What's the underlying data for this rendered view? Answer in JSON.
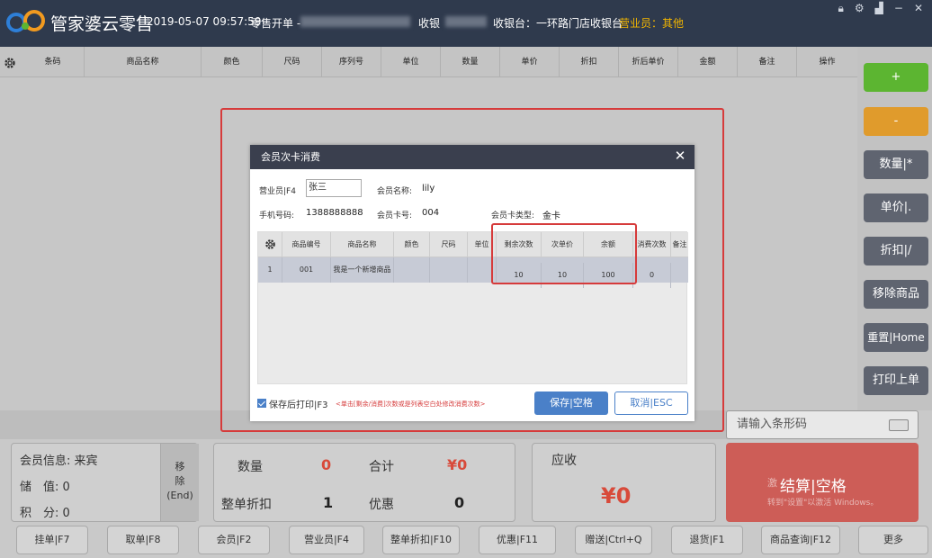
{
  "header": {
    "app_title": "管家婆云零售",
    "datetime": "2019-05-07 09:57:59",
    "shift_label": "零售开单 -",
    "cashier_label": "收银",
    "register": "收银台：一环路门店收银台",
    "salesman": "营业员：其他"
  },
  "grid": {
    "columns": [
      "条码",
      "商品名称",
      "颜色",
      "尺码",
      "序列号",
      "单位",
      "数量",
      "单价",
      "折扣",
      "折后单价",
      "金额",
      "备注",
      "操作"
    ]
  },
  "right_buttons": {
    "add": "+",
    "minus": "-",
    "quantity": "数量|*",
    "price": "单价|.",
    "discount": "折扣|/",
    "remove_item": "移除商品",
    "reset": "重置|Home",
    "print_last": "打印上单"
  },
  "barcode": {
    "placeholder": "请输入条形码"
  },
  "member_panel": {
    "info_label": "会员信息: 来宾",
    "stored_label": "储　值: 0",
    "points_label": "积　分: 0",
    "remove_btn": "移除(End)",
    "remove_l1": "移",
    "remove_l2": "除",
    "remove_l3": "(End)"
  },
  "summary": {
    "qty_label": "数量",
    "qty_value": "0",
    "total_label": "合计",
    "total_value": "¥0",
    "discount_label": "整单折扣",
    "discount_value": "1",
    "promo_label": "优惠",
    "promo_value": "0"
  },
  "receivable": {
    "label": "应收",
    "value": "¥0"
  },
  "checkout": {
    "label": "结算|空格",
    "wm_prefix": "激",
    "watermark2": "转到\"设置\"以激活 Windows。"
  },
  "function_buttons": [
    "挂单|F7",
    "取单|F8",
    "会员|F2",
    "营业员|F4",
    "整单折扣|F10",
    "优惠|F11",
    "赠送|Ctrl+Q",
    "退货|F1",
    "商品查询|F12",
    "更多"
  ],
  "modal": {
    "title": "会员次卡消费",
    "salesman_label": "营业员|F4",
    "salesman_value": "张三",
    "member_name_label": "会员名称:",
    "member_name": "lily",
    "phone_label": "手机号码:",
    "phone": "1388888888",
    "card_no_label": "会员卡号:",
    "card_no": "004",
    "card_type_label": "会员卡类型:",
    "card_type": "金卡",
    "table": {
      "headers": [
        "商品编号",
        "商品名称",
        "颜色",
        "尺码",
        "单位",
        "剩余次数",
        "次单价",
        "余额",
        "消费次数",
        "备注"
      ],
      "rows": [
        {
          "index": "1",
          "code": "001",
          "name": "我是一个新增商品",
          "color": "",
          "size": "",
          "unit": "",
          "remaining": "10",
          "unit_price": "10",
          "balance": "100",
          "consume": "0",
          "note": ""
        }
      ]
    },
    "print_after_save": "保存后打印|F3",
    "hint": "<单击[剩余/消费]次数或是列表空白处修改消费次数>",
    "save_btn": "保存|空格",
    "cancel_btn": "取消|ESC"
  },
  "colors": {
    "header_bg": "#2f3a4d",
    "add_btn": "#5cb531",
    "minus_btn": "#e09b2c",
    "side_btn": "#5f6470",
    "checkout_bg": "#cd5d57",
    "salesman_text": "#f2b500",
    "primary_blue": "#4a80c8",
    "highlight_red": "#d63b3b"
  }
}
